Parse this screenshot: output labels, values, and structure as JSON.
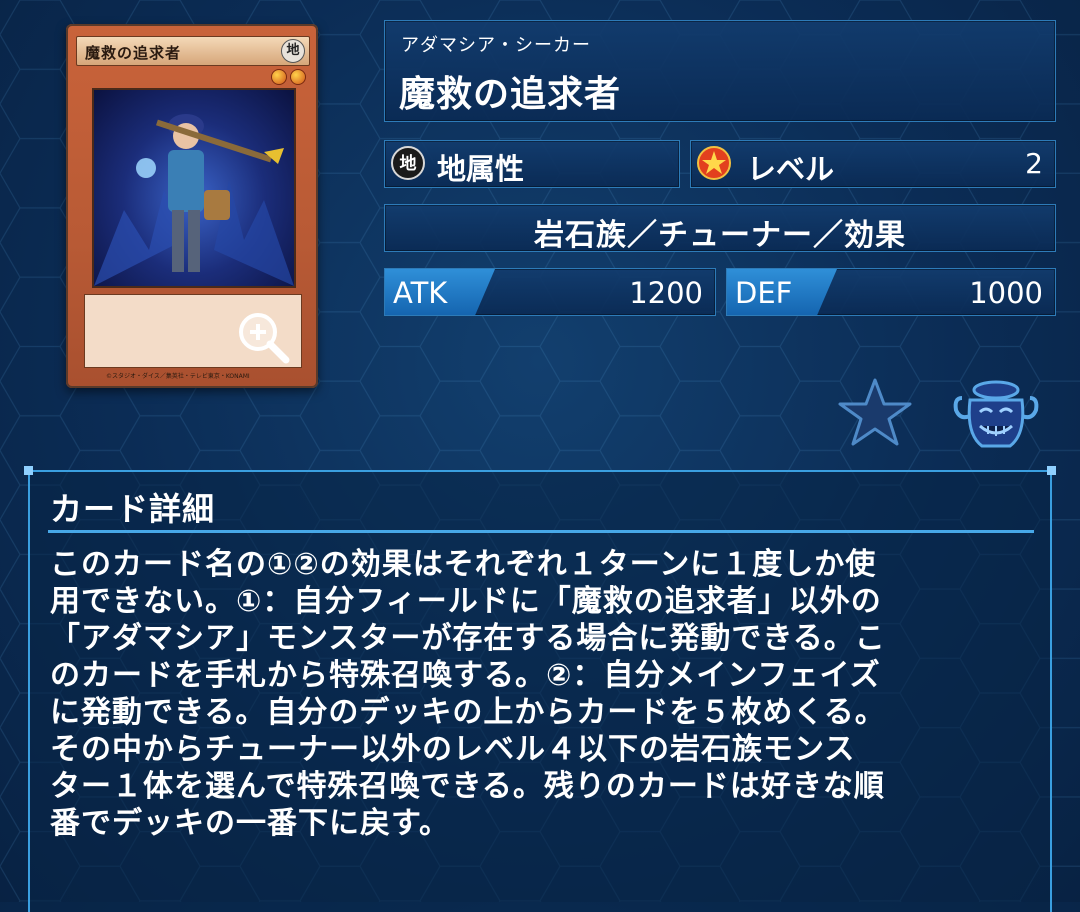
{
  "card": {
    "image_name": "魔救の追求者",
    "image_attr": "地",
    "level_stars": 2,
    "copyright": "©スタジオ・ダイス／集英社・テレビ東京・KONAMI"
  },
  "name_ruby": "アダマシア・シーカー",
  "name": "魔救の追求者",
  "attribute": {
    "icon_char": "地",
    "label": "地属性"
  },
  "level": {
    "label": "レベル",
    "value": "2"
  },
  "type_line": "岩石族／チューナー／効果",
  "atk": {
    "label": "ATK",
    "value": "1200"
  },
  "def": {
    "label": "DEF",
    "value": "1000"
  },
  "detail": {
    "title": "カード詳細",
    "text": "このカード名の①②の効果はそれぞれ１ターンに１度しか使\n用できない。①：自分フィールドに「魔救の追求者」以外の\n「アダマシア」モンスターが存在する場合に発動できる。こ\nのカードを手札から特殊召喚する。②：自分メインフェイズ\nに発動できる。自分のデッキの上からカードを５枚めくる。\nその中からチューナー以外のレベル４以下の岩石族モンス\nター１体を選んで特殊召喚できる。残りのカードは好きな順\n番でデッキの一番下に戻す。"
  },
  "icons": {
    "zoom": "zoom-in-icon",
    "favorite": "star-icon",
    "pot": "pot-of-greed-icon"
  },
  "colors": {
    "background": "#0b2c55",
    "panel_border": "#2d7bb8",
    "stat_tag": "#1f78c4",
    "card_frame": "#c9633a"
  }
}
